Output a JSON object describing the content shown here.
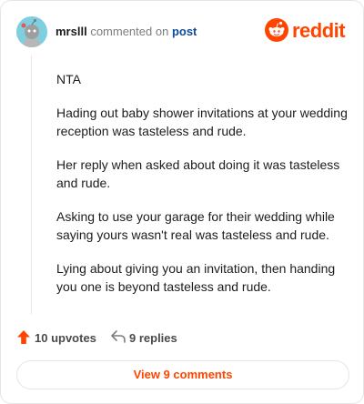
{
  "header": {
    "username": "mrslll",
    "action_text": "commented on",
    "post_link": "post",
    "brand": "reddit"
  },
  "comment": {
    "paragraphs": [
      "NTA",
      "Hading out baby shower invitations at your wedding reception was tasteless and rude.",
      "Her reply when asked about doing it was tasteless and rude.",
      "Asking to use your garage for their wedding while saying yours wasn't real was tasteless and rude.",
      "Lying about giving you an invitation, then handing you one is beyond tasteless and rude."
    ]
  },
  "footer": {
    "upvotes_label": "10 upvotes",
    "replies_label": "9 replies",
    "view_comments_label": "View 9 comments"
  },
  "icons": {
    "avatar": "snoo-avatar-icon",
    "brand": "reddit-logo-icon",
    "upvote": "upvote-arrow-icon",
    "reply": "reply-arrow-icon"
  },
  "colors": {
    "brand": "#ff4500",
    "link": "#0f4a9e",
    "muted": "#7c7c7c",
    "avatar_bg": "#7ecfe0"
  }
}
